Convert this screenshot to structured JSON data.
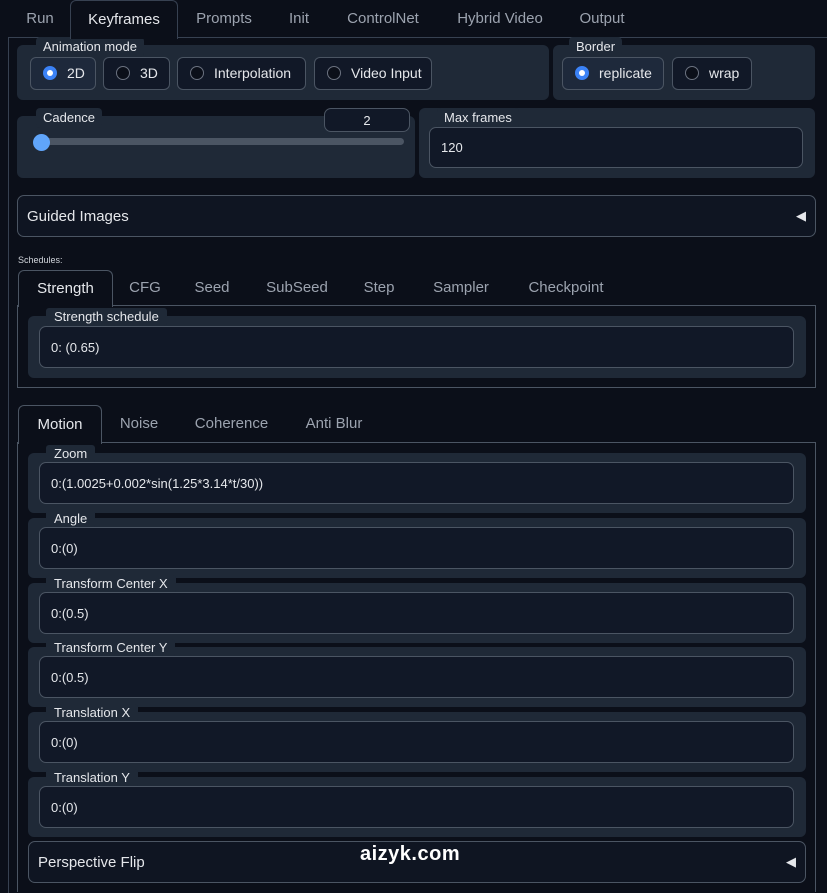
{
  "top_tabs": [
    "Run",
    "Keyframes",
    "Prompts",
    "Init",
    "ControlNet",
    "Hybrid Video",
    "Output"
  ],
  "animation_mode": {
    "label": "Animation mode",
    "options": [
      "2D",
      "3D",
      "Interpolation",
      "Video Input"
    ],
    "selected": "2D"
  },
  "border": {
    "label": "Border",
    "options": [
      "replicate",
      "wrap"
    ],
    "selected": "replicate"
  },
  "cadence": {
    "label": "Cadence",
    "value": "2",
    "slider_fraction": 0.0
  },
  "max_frames": {
    "label": "Max frames",
    "value": "120"
  },
  "guided_images": {
    "label": "Guided Images",
    "arrow": "◀"
  },
  "schedules": {
    "caption": "Schedules:",
    "tabs": [
      "Strength",
      "CFG",
      "Seed",
      "SubSeed",
      "Step",
      "Sampler",
      "Checkpoint"
    ],
    "active_tab": "Strength",
    "strength_schedule": {
      "label": "Strength schedule",
      "value": "0: (0.65)"
    }
  },
  "motion": {
    "tabs": [
      "Motion",
      "Noise",
      "Coherence",
      "Anti Blur"
    ],
    "active_tab": "Motion",
    "fields": [
      {
        "label": "Zoom",
        "value": "0:(1.0025+0.002*sin(1.25*3.14*t/30))"
      },
      {
        "label": "Angle",
        "value": "0:(0)"
      },
      {
        "label": "Transform Center X",
        "value": "0:(0.5)"
      },
      {
        "label": "Transform Center Y",
        "value": "0:(0.5)"
      },
      {
        "label": "Translation X",
        "value": "0:(0)"
      },
      {
        "label": "Translation Y",
        "value": "0:(0)"
      }
    ],
    "perspective_flip": {
      "label": "Perspective Flip",
      "arrow": "◀"
    }
  },
  "watermark": "aizyk.com"
}
